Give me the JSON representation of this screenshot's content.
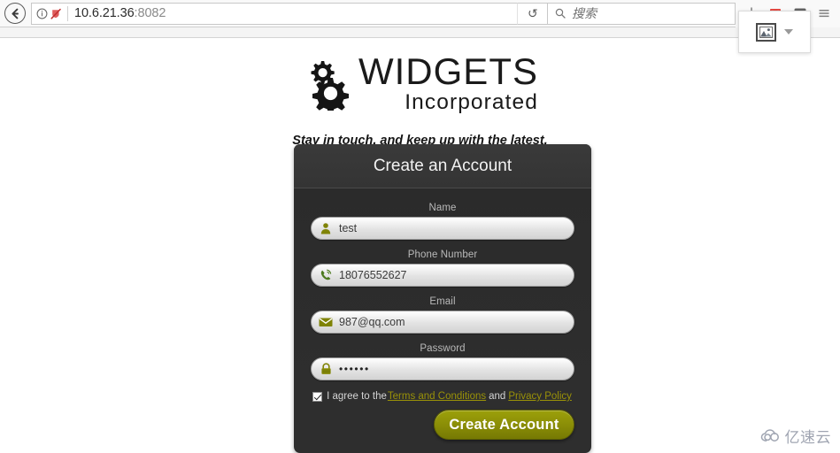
{
  "browser": {
    "back_label": "Back",
    "url": "10.6.21.36",
    "url_port": ":8082",
    "identity_icon": "info-icon",
    "shield_icon": "tracking-protection-disabled-icon",
    "reload_label": "↻",
    "search_placeholder": "搜索",
    "search_icon": "magnifier-icon",
    "toolbar_icons": [
      "downloads-icon",
      "pocket-icon",
      "library-icon",
      "menu-icon"
    ],
    "capture_popup": {
      "image_button": "image-thumbnail-icon",
      "caret": "chevron-down-icon"
    }
  },
  "site": {
    "logo": {
      "primary": "WIDGETS",
      "secondary": "Incorporated",
      "icon": "gears-icon"
    },
    "tagline": "Stay in touch, and keep up with the latest."
  },
  "signup": {
    "title": "Create an Account",
    "fields": [
      {
        "label": "Name",
        "value": "test",
        "icon": "user-icon",
        "type": "text"
      },
      {
        "label": "Phone Number",
        "value": "18076552627",
        "icon": "phone-icon",
        "type": "tel"
      },
      {
        "label": "Email",
        "value": "987@qq.com",
        "icon": "envelope-icon",
        "type": "email"
      },
      {
        "label": "Password",
        "value": "••••••",
        "icon": "lock-icon",
        "type": "password"
      }
    ],
    "terms": {
      "checked": true,
      "prefix": "I agree to the",
      "link1": "Terms and Conditions",
      "conjunction": "and",
      "link2": "Privacy Policy"
    },
    "submit_label": "Create Account",
    "accent_color": "#8b8e07",
    "link_color": "#9a9208",
    "card_bg": "#2e2e2e"
  },
  "watermark": {
    "text": "亿速云",
    "icon": "cloud-icon"
  }
}
